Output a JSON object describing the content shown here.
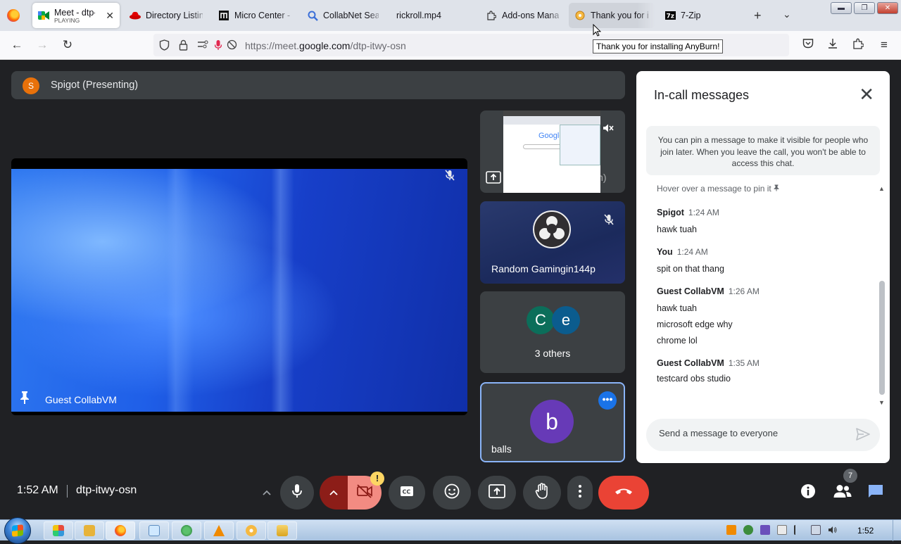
{
  "browser": {
    "tabs": [
      {
        "label": "Meet - dtp-itwy-osn",
        "sub": "PLAYING",
        "icon": "google-meet-icon",
        "active": true
      },
      {
        "label": "Directory Listing",
        "icon": "redhat-icon"
      },
      {
        "label": "Micro Center - Computer",
        "icon": "microcenter-icon"
      },
      {
        "label": "CollabNet Search",
        "icon": "search-icon"
      },
      {
        "label": "rickroll.mp4",
        "icon": ""
      },
      {
        "label": "Add-ons Manager",
        "icon": "puzzle-icon"
      },
      {
        "label": "Thank you for installing",
        "icon": "anyburn-icon",
        "hover": true
      },
      {
        "label": "7-Zip",
        "icon": "7zip-icon"
      }
    ],
    "url_prefix": "https://meet.",
    "url_domain": "google.com",
    "url_path": "/dtp-itwy-osn",
    "tooltip": "Thank you for installing AnyBurn!"
  },
  "meet": {
    "presenting_initial": "S",
    "presenting_label": "Spigot (Presenting)",
    "main_tile_name": "Guest CollabVM",
    "tiles": {
      "presentation": {
        "label": "Spigot (Presentation)",
        "screen_logo": "Google"
      },
      "obs": {
        "name": "Random Gamingin144p"
      },
      "others": {
        "initials": [
          "C",
          "e"
        ],
        "label": "3 others"
      },
      "self": {
        "initial": "b",
        "name": "balls"
      }
    },
    "chat": {
      "title": "In-call messages",
      "notice": "You can pin a message to make it visible for people who join later. When you leave the call, you won't be able to access this chat.",
      "hint": "Hover over a message to pin it",
      "messages": [
        {
          "from": "Spigot",
          "time": "1:24 AM",
          "lines": [
            "hawk tuah"
          ]
        },
        {
          "from": "You",
          "time": "1:24 AM",
          "lines": [
            "spit on that thang"
          ]
        },
        {
          "from": "Guest CollabVM",
          "time": "1:26 AM",
          "lines": [
            "hawk tuah",
            "microsoft edge why",
            "chrome lol"
          ]
        },
        {
          "from": "Guest CollabVM",
          "time": "1:35 AM",
          "lines": [
            "testcard obs studio"
          ]
        }
      ],
      "input_placeholder": "Send a message to everyone"
    },
    "bottom": {
      "time": "1:52 AM",
      "meeting_code": "dtp-itwy-osn",
      "warning_badge": "!",
      "people_count": "7"
    }
  },
  "taskbar": {
    "clock": "1:52"
  },
  "colors": {
    "meet_bg": "#202124",
    "tile_bg": "#3c4043",
    "hangup_red": "#ea4335",
    "cam_off_pink": "#f28b82",
    "accent_blue": "#8ab4f8",
    "self_avatar": "#673ab7",
    "presenter_avatar": "#e8710a",
    "other_avatar_c": "#0b6e5a",
    "other_avatar_e": "#0b5c8e"
  }
}
